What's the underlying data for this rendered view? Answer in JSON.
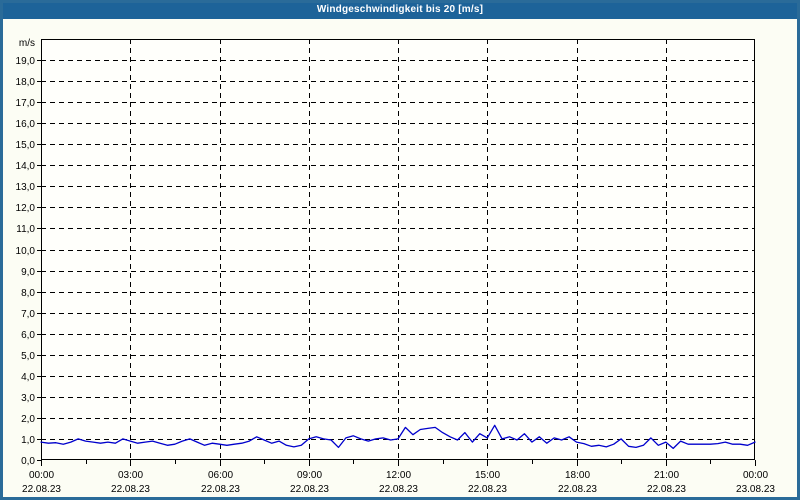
{
  "colors": {
    "title_bar_bg": "#1d6399",
    "title_text": "#ffffff",
    "page_bg": "#fcfdf4",
    "plot_bg": "#fffffb",
    "frame_border": "#2a6b99",
    "grid": "#000000",
    "axis": "#000000",
    "label_text": "#000000",
    "series_line": "#0000cc"
  },
  "chart_data": {
    "type": "line",
    "title": "Windgeschwindigkeit bis 20 [m/s]",
    "unit_label": "m/s",
    "xlim_hours": [
      0,
      24
    ],
    "ylim": [
      0,
      20
    ],
    "grid_style": "dashed black, horizontal every 1.0 m/s, vertical every 3 h",
    "legend": "none",
    "y_tick_labels": [
      "0,0",
      "1,0",
      "2,0",
      "3,0",
      "4,0",
      "5,0",
      "6,0",
      "7,0",
      "8,0",
      "9,0",
      "10,0",
      "11,0",
      "12,0",
      "13,0",
      "14,0",
      "15,0",
      "16,0",
      "17,0",
      "18,0",
      "19,0"
    ],
    "x_major_ticks": [
      {
        "hour": 0,
        "time": "00:00",
        "date": "22.08.23"
      },
      {
        "hour": 3,
        "time": "03:00",
        "date": "22.08.23"
      },
      {
        "hour": 6,
        "time": "06:00",
        "date": "22.08.23"
      },
      {
        "hour": 9,
        "time": "09:00",
        "date": "22.08.23"
      },
      {
        "hour": 12,
        "time": "12:00",
        "date": "22.08.23"
      },
      {
        "hour": 15,
        "time": "15:00",
        "date": "22.08.23"
      },
      {
        "hour": 18,
        "time": "18:00",
        "date": "22.08.23"
      },
      {
        "hour": 21,
        "time": "21:00",
        "date": "22.08.23"
      },
      {
        "hour": 24,
        "time": "00:00",
        "date": "23.08.23"
      }
    ],
    "x_minor_tick_interval_hours": 1.5,
    "series": [
      {
        "name": "Windgeschwindigkeit",
        "color": "#0000cc",
        "x_start_hour": 0,
        "x_step_hours": 0.25,
        "values": [
          0.85,
          0.8,
          0.82,
          0.75,
          0.85,
          1.0,
          0.9,
          0.85,
          0.8,
          0.85,
          0.8,
          1.0,
          0.9,
          0.8,
          0.85,
          0.9,
          0.8,
          0.7,
          0.75,
          0.9,
          1.0,
          0.85,
          0.7,
          0.8,
          0.75,
          0.7,
          0.75,
          0.8,
          0.9,
          1.1,
          0.95,
          0.8,
          0.9,
          0.7,
          0.62,
          0.7,
          1.0,
          1.1,
          1.0,
          0.95,
          0.6,
          1.05,
          1.15,
          1.0,
          0.9,
          1.0,
          1.05,
          0.95,
          1.0,
          1.55,
          1.2,
          1.45,
          1.5,
          1.55,
          1.3,
          1.1,
          0.95,
          1.3,
          0.85,
          1.25,
          1.05,
          1.65,
          1.0,
          1.1,
          0.95,
          1.25,
          0.85,
          1.1,
          0.8,
          1.05,
          0.95,
          1.1,
          0.85,
          0.78,
          0.65,
          0.7,
          0.62,
          0.75,
          1.0,
          0.65,
          0.6,
          0.7,
          1.05,
          0.7,
          0.85,
          0.55,
          0.9,
          0.75,
          0.75,
          0.75,
          0.75,
          0.78,
          0.85,
          0.75,
          0.75,
          0.7,
          0.85
        ]
      }
    ]
  }
}
